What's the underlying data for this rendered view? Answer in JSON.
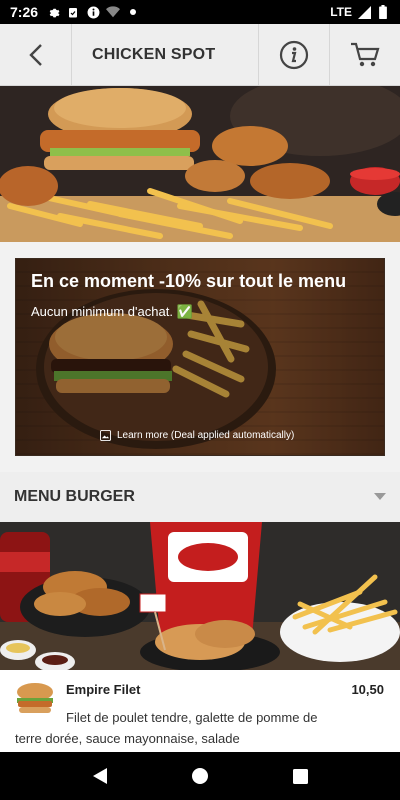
{
  "status_bar": {
    "time": "7:26",
    "network": "LTE"
  },
  "app_bar": {
    "title": "CHICKEN SPOT"
  },
  "promo": {
    "headline": "En ce moment -10% sur tout le menu",
    "subtext": "Aucun minimum d'achat. ✅",
    "learn_more": "Learn more (Deal applied automatically)"
  },
  "menu_section": {
    "label": "MENU BURGER"
  },
  "items": [
    {
      "name": "Empire Filet",
      "price": "10,50",
      "description": "Filet de poulet tendre, galette de pomme de terre dorée, sauce mayonnaise, salade"
    }
  ],
  "colors": {
    "app_bar_bg": "#eeeeee",
    "status_bar_bg": "#000000",
    "accent_text": "#333333"
  }
}
